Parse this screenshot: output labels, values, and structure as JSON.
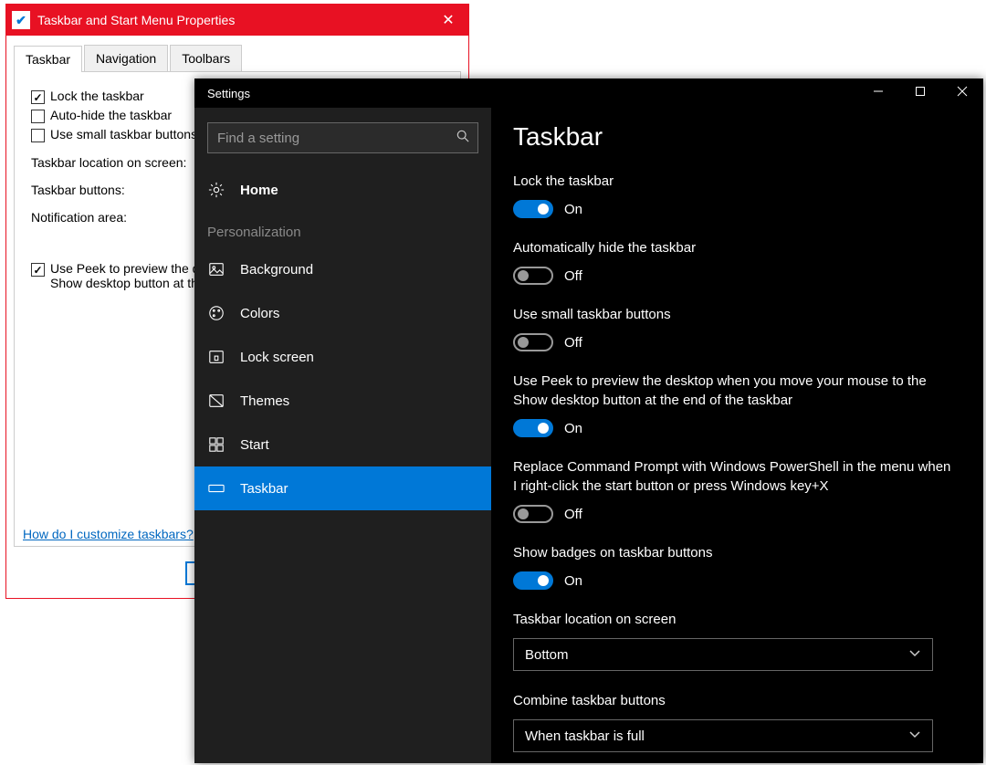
{
  "legacy": {
    "title": "Taskbar and Start Menu Properties",
    "tabs": [
      "Taskbar",
      "Navigation",
      "Toolbars"
    ],
    "checks": {
      "lock": "Lock the taskbar",
      "autohide": "Auto-hide the taskbar",
      "small": "Use small taskbar buttons",
      "peek1": "Use Peek to preview the de",
      "peek2": "Show desktop button at th"
    },
    "labels": {
      "location": "Taskbar location on screen:",
      "buttons": "Taskbar buttons:",
      "notif": "Notification area:"
    },
    "link": "How do I customize taskbars?"
  },
  "settings": {
    "title": "Settings",
    "search_placeholder": "Find a setting",
    "home": "Home",
    "section": "Personalization",
    "nav": {
      "background": "Background",
      "colors": "Colors",
      "lockscreen": "Lock screen",
      "themes": "Themes",
      "start": "Start",
      "taskbar": "Taskbar"
    },
    "main": {
      "heading": "Taskbar",
      "lock": {
        "label": "Lock the taskbar",
        "state": "On"
      },
      "autohide": {
        "label": "Automatically hide the taskbar",
        "state": "Off"
      },
      "small": {
        "label": "Use small taskbar buttons",
        "state": "Off"
      },
      "peek": {
        "label": "Use Peek to preview the desktop when you move your mouse to the Show desktop button at the end of the taskbar",
        "state": "On"
      },
      "powershell": {
        "label": "Replace Command Prompt with Windows PowerShell in the menu when I right-click the start button or press Windows key+X",
        "state": "Off"
      },
      "badges": {
        "label": "Show badges on taskbar buttons",
        "state": "On"
      },
      "location": {
        "label": "Taskbar location on screen",
        "value": "Bottom"
      },
      "combine": {
        "label": "Combine taskbar buttons",
        "value": "When taskbar is full"
      }
    }
  }
}
